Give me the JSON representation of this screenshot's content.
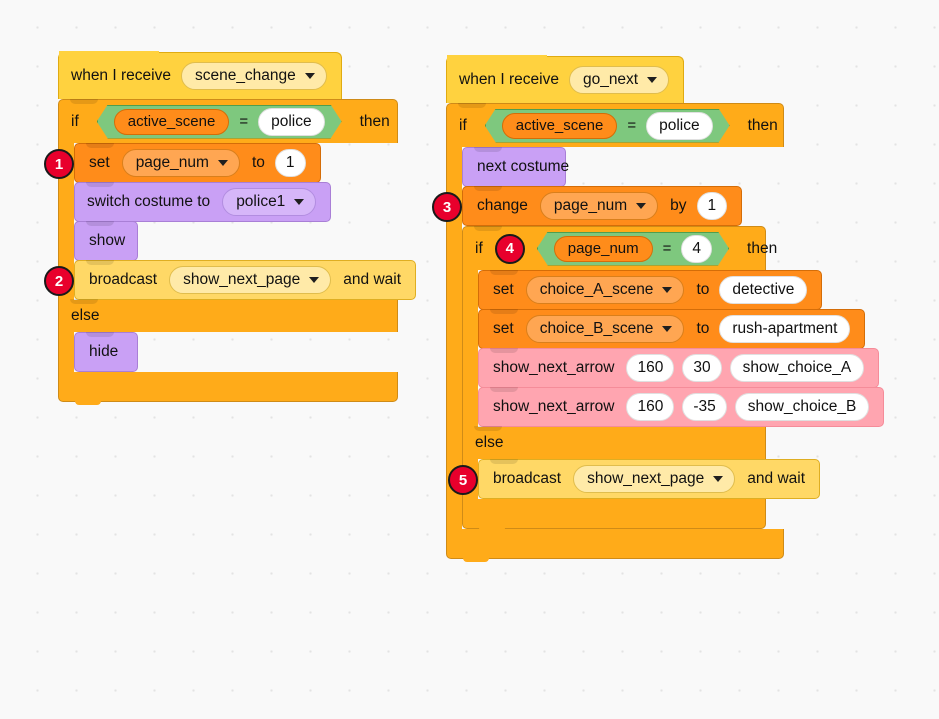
{
  "workspace": {
    "background_color": "#f9f9f9",
    "grid_dot_color": "#e3e3e3"
  },
  "palette": {
    "events_hat": "#ffd23f",
    "control": "#ffab19",
    "variables": "#ff8c1a",
    "looks": "#c9a0f5",
    "events": "#ffd866",
    "custom": "#ffa5b0",
    "operators": "#7ec87e",
    "badge": "#e8002c"
  },
  "scripts": [
    {
      "id": "script-scene-change",
      "hat": {
        "label": "when I receive",
        "dropdown": "scene_change"
      },
      "if_label": "if",
      "then_label": "then",
      "else_label": "else",
      "condition": {
        "variable": "active_scene",
        "operator": "=",
        "value": "police"
      },
      "then_blocks": [
        {
          "type": "set",
          "label": "set",
          "variable": "page_num",
          "to_label": "to",
          "value": "1",
          "badge": "1"
        },
        {
          "type": "looks",
          "label": "switch costume to",
          "dropdown": "police1"
        },
        {
          "type": "looks",
          "label": "show"
        },
        {
          "type": "broadcast",
          "label": "broadcast",
          "dropdown": "show_next_page",
          "suffix": "and wait",
          "badge": "2"
        }
      ],
      "else_blocks": [
        {
          "type": "looks",
          "label": "hide"
        }
      ]
    },
    {
      "id": "script-go-next",
      "hat": {
        "label": "when I receive",
        "dropdown": "go_next"
      },
      "if_label": "if",
      "then_label": "then",
      "else_label": "else",
      "condition": {
        "variable": "active_scene",
        "operator": "=",
        "value": "police"
      },
      "then_blocks": [
        {
          "type": "looks",
          "label": "next costume"
        },
        {
          "type": "change",
          "label": "change",
          "variable": "page_num",
          "by_label": "by",
          "value": "1",
          "badge": "3"
        }
      ],
      "inner_if": {
        "badge": "4",
        "if_label": "if",
        "then_label": "then",
        "else_label": "else",
        "condition": {
          "variable": "page_num",
          "operator": "=",
          "value": "4"
        },
        "then_blocks": [
          {
            "type": "set",
            "label": "set",
            "variable": "choice_A_scene",
            "to_label": "to",
            "value": "detective"
          },
          {
            "type": "set",
            "label": "set",
            "variable": "choice_B_scene",
            "to_label": "to",
            "value": "rush-apartment"
          },
          {
            "type": "custom",
            "label": "show_next_arrow",
            "args": [
              "160",
              "30",
              "show_choice_A"
            ]
          },
          {
            "type": "custom",
            "label": "show_next_arrow",
            "args": [
              "160",
              "-35",
              "show_choice_B"
            ]
          }
        ],
        "else_blocks": [
          {
            "type": "broadcast",
            "label": "broadcast",
            "dropdown": "show_next_page",
            "suffix": "and wait",
            "badge": "5"
          }
        ]
      }
    }
  ]
}
